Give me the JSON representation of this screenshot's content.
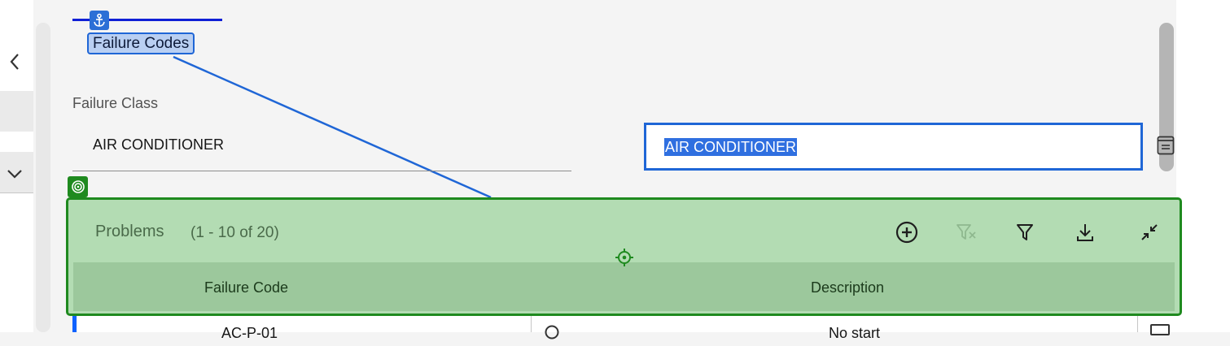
{
  "nav": {
    "back_icon": "chevron-left-icon",
    "expand_icon": "chevron-down-icon"
  },
  "header": {
    "anchor_icon": "anchor-icon",
    "title": "Failure Codes"
  },
  "failure_class": {
    "label": "Failure Class",
    "value": "AIR CONDITIONER"
  },
  "description_field": {
    "value": "AIR CONDITIONER",
    "lookup_icon": "lookup-icon"
  },
  "problems": {
    "badge_icon": "target-icon",
    "title": "Problems",
    "count": "(1 - 10 of 20)",
    "toolbar": {
      "add_icon": "add-circle-icon",
      "clear_filter_icon": "clear-filter-icon",
      "filter_icon": "filter-icon",
      "download_icon": "download-icon",
      "collapse_icon": "minimize-icon"
    },
    "columns": [
      "Failure Code",
      "Description"
    ],
    "marker_icon": "crosshair-icon"
  },
  "partial_row": {
    "failure_code": "AC-P-01",
    "description": "No start",
    "search_icon": "search-icon",
    "details_icon": "details-icon"
  },
  "colors": {
    "highlight_blue": "#1f66d6",
    "target_green": "#1f8a1f",
    "panel_green": "#b3dcb3",
    "header_green": "#9cc89c"
  }
}
